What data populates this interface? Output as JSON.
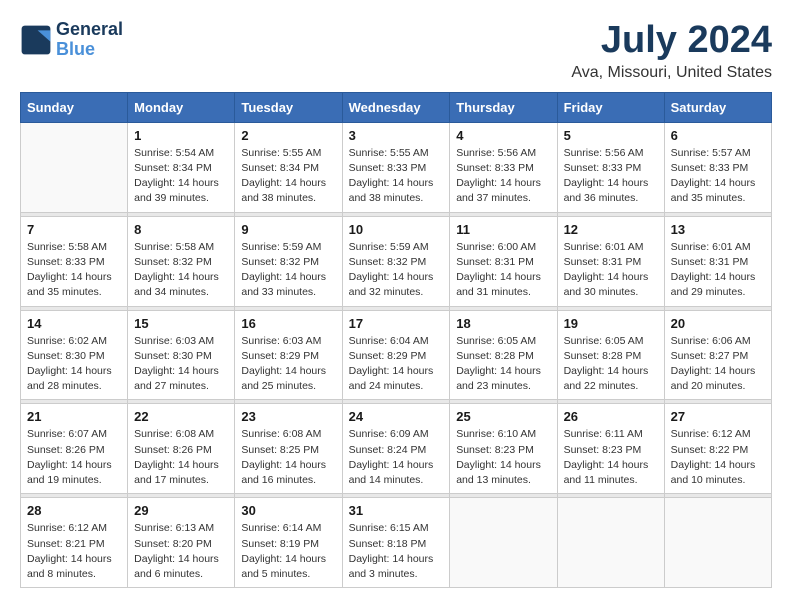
{
  "logo": {
    "line1": "General",
    "line2": "Blue"
  },
  "title": "July 2024",
  "subtitle": "Ava, Missouri, United States",
  "days_of_week": [
    "Sunday",
    "Monday",
    "Tuesday",
    "Wednesday",
    "Thursday",
    "Friday",
    "Saturday"
  ],
  "weeks": [
    {
      "days": [
        {
          "day": "",
          "info": ""
        },
        {
          "day": "1",
          "info": "Sunrise: 5:54 AM\nSunset: 8:34 PM\nDaylight: 14 hours\nand 39 minutes."
        },
        {
          "day": "2",
          "info": "Sunrise: 5:55 AM\nSunset: 8:34 PM\nDaylight: 14 hours\nand 38 minutes."
        },
        {
          "day": "3",
          "info": "Sunrise: 5:55 AM\nSunset: 8:33 PM\nDaylight: 14 hours\nand 38 minutes."
        },
        {
          "day": "4",
          "info": "Sunrise: 5:56 AM\nSunset: 8:33 PM\nDaylight: 14 hours\nand 37 minutes."
        },
        {
          "day": "5",
          "info": "Sunrise: 5:56 AM\nSunset: 8:33 PM\nDaylight: 14 hours\nand 36 minutes."
        },
        {
          "day": "6",
          "info": "Sunrise: 5:57 AM\nSunset: 8:33 PM\nDaylight: 14 hours\nand 35 minutes."
        }
      ]
    },
    {
      "days": [
        {
          "day": "7",
          "info": "Sunrise: 5:58 AM\nSunset: 8:33 PM\nDaylight: 14 hours\nand 35 minutes."
        },
        {
          "day": "8",
          "info": "Sunrise: 5:58 AM\nSunset: 8:32 PM\nDaylight: 14 hours\nand 34 minutes."
        },
        {
          "day": "9",
          "info": "Sunrise: 5:59 AM\nSunset: 8:32 PM\nDaylight: 14 hours\nand 33 minutes."
        },
        {
          "day": "10",
          "info": "Sunrise: 5:59 AM\nSunset: 8:32 PM\nDaylight: 14 hours\nand 32 minutes."
        },
        {
          "day": "11",
          "info": "Sunrise: 6:00 AM\nSunset: 8:31 PM\nDaylight: 14 hours\nand 31 minutes."
        },
        {
          "day": "12",
          "info": "Sunrise: 6:01 AM\nSunset: 8:31 PM\nDaylight: 14 hours\nand 30 minutes."
        },
        {
          "day": "13",
          "info": "Sunrise: 6:01 AM\nSunset: 8:31 PM\nDaylight: 14 hours\nand 29 minutes."
        }
      ]
    },
    {
      "days": [
        {
          "day": "14",
          "info": "Sunrise: 6:02 AM\nSunset: 8:30 PM\nDaylight: 14 hours\nand 28 minutes."
        },
        {
          "day": "15",
          "info": "Sunrise: 6:03 AM\nSunset: 8:30 PM\nDaylight: 14 hours\nand 27 minutes."
        },
        {
          "day": "16",
          "info": "Sunrise: 6:03 AM\nSunset: 8:29 PM\nDaylight: 14 hours\nand 25 minutes."
        },
        {
          "day": "17",
          "info": "Sunrise: 6:04 AM\nSunset: 8:29 PM\nDaylight: 14 hours\nand 24 minutes."
        },
        {
          "day": "18",
          "info": "Sunrise: 6:05 AM\nSunset: 8:28 PM\nDaylight: 14 hours\nand 23 minutes."
        },
        {
          "day": "19",
          "info": "Sunrise: 6:05 AM\nSunset: 8:28 PM\nDaylight: 14 hours\nand 22 minutes."
        },
        {
          "day": "20",
          "info": "Sunrise: 6:06 AM\nSunset: 8:27 PM\nDaylight: 14 hours\nand 20 minutes."
        }
      ]
    },
    {
      "days": [
        {
          "day": "21",
          "info": "Sunrise: 6:07 AM\nSunset: 8:26 PM\nDaylight: 14 hours\nand 19 minutes."
        },
        {
          "day": "22",
          "info": "Sunrise: 6:08 AM\nSunset: 8:26 PM\nDaylight: 14 hours\nand 17 minutes."
        },
        {
          "day": "23",
          "info": "Sunrise: 6:08 AM\nSunset: 8:25 PM\nDaylight: 14 hours\nand 16 minutes."
        },
        {
          "day": "24",
          "info": "Sunrise: 6:09 AM\nSunset: 8:24 PM\nDaylight: 14 hours\nand 14 minutes."
        },
        {
          "day": "25",
          "info": "Sunrise: 6:10 AM\nSunset: 8:23 PM\nDaylight: 14 hours\nand 13 minutes."
        },
        {
          "day": "26",
          "info": "Sunrise: 6:11 AM\nSunset: 8:23 PM\nDaylight: 14 hours\nand 11 minutes."
        },
        {
          "day": "27",
          "info": "Sunrise: 6:12 AM\nSunset: 8:22 PM\nDaylight: 14 hours\nand 10 minutes."
        }
      ]
    },
    {
      "days": [
        {
          "day": "28",
          "info": "Sunrise: 6:12 AM\nSunset: 8:21 PM\nDaylight: 14 hours\nand 8 minutes."
        },
        {
          "day": "29",
          "info": "Sunrise: 6:13 AM\nSunset: 8:20 PM\nDaylight: 14 hours\nand 6 minutes."
        },
        {
          "day": "30",
          "info": "Sunrise: 6:14 AM\nSunset: 8:19 PM\nDaylight: 14 hours\nand 5 minutes."
        },
        {
          "day": "31",
          "info": "Sunrise: 6:15 AM\nSunset: 8:18 PM\nDaylight: 14 hours\nand 3 minutes."
        },
        {
          "day": "",
          "info": ""
        },
        {
          "day": "",
          "info": ""
        },
        {
          "day": "",
          "info": ""
        }
      ]
    }
  ]
}
